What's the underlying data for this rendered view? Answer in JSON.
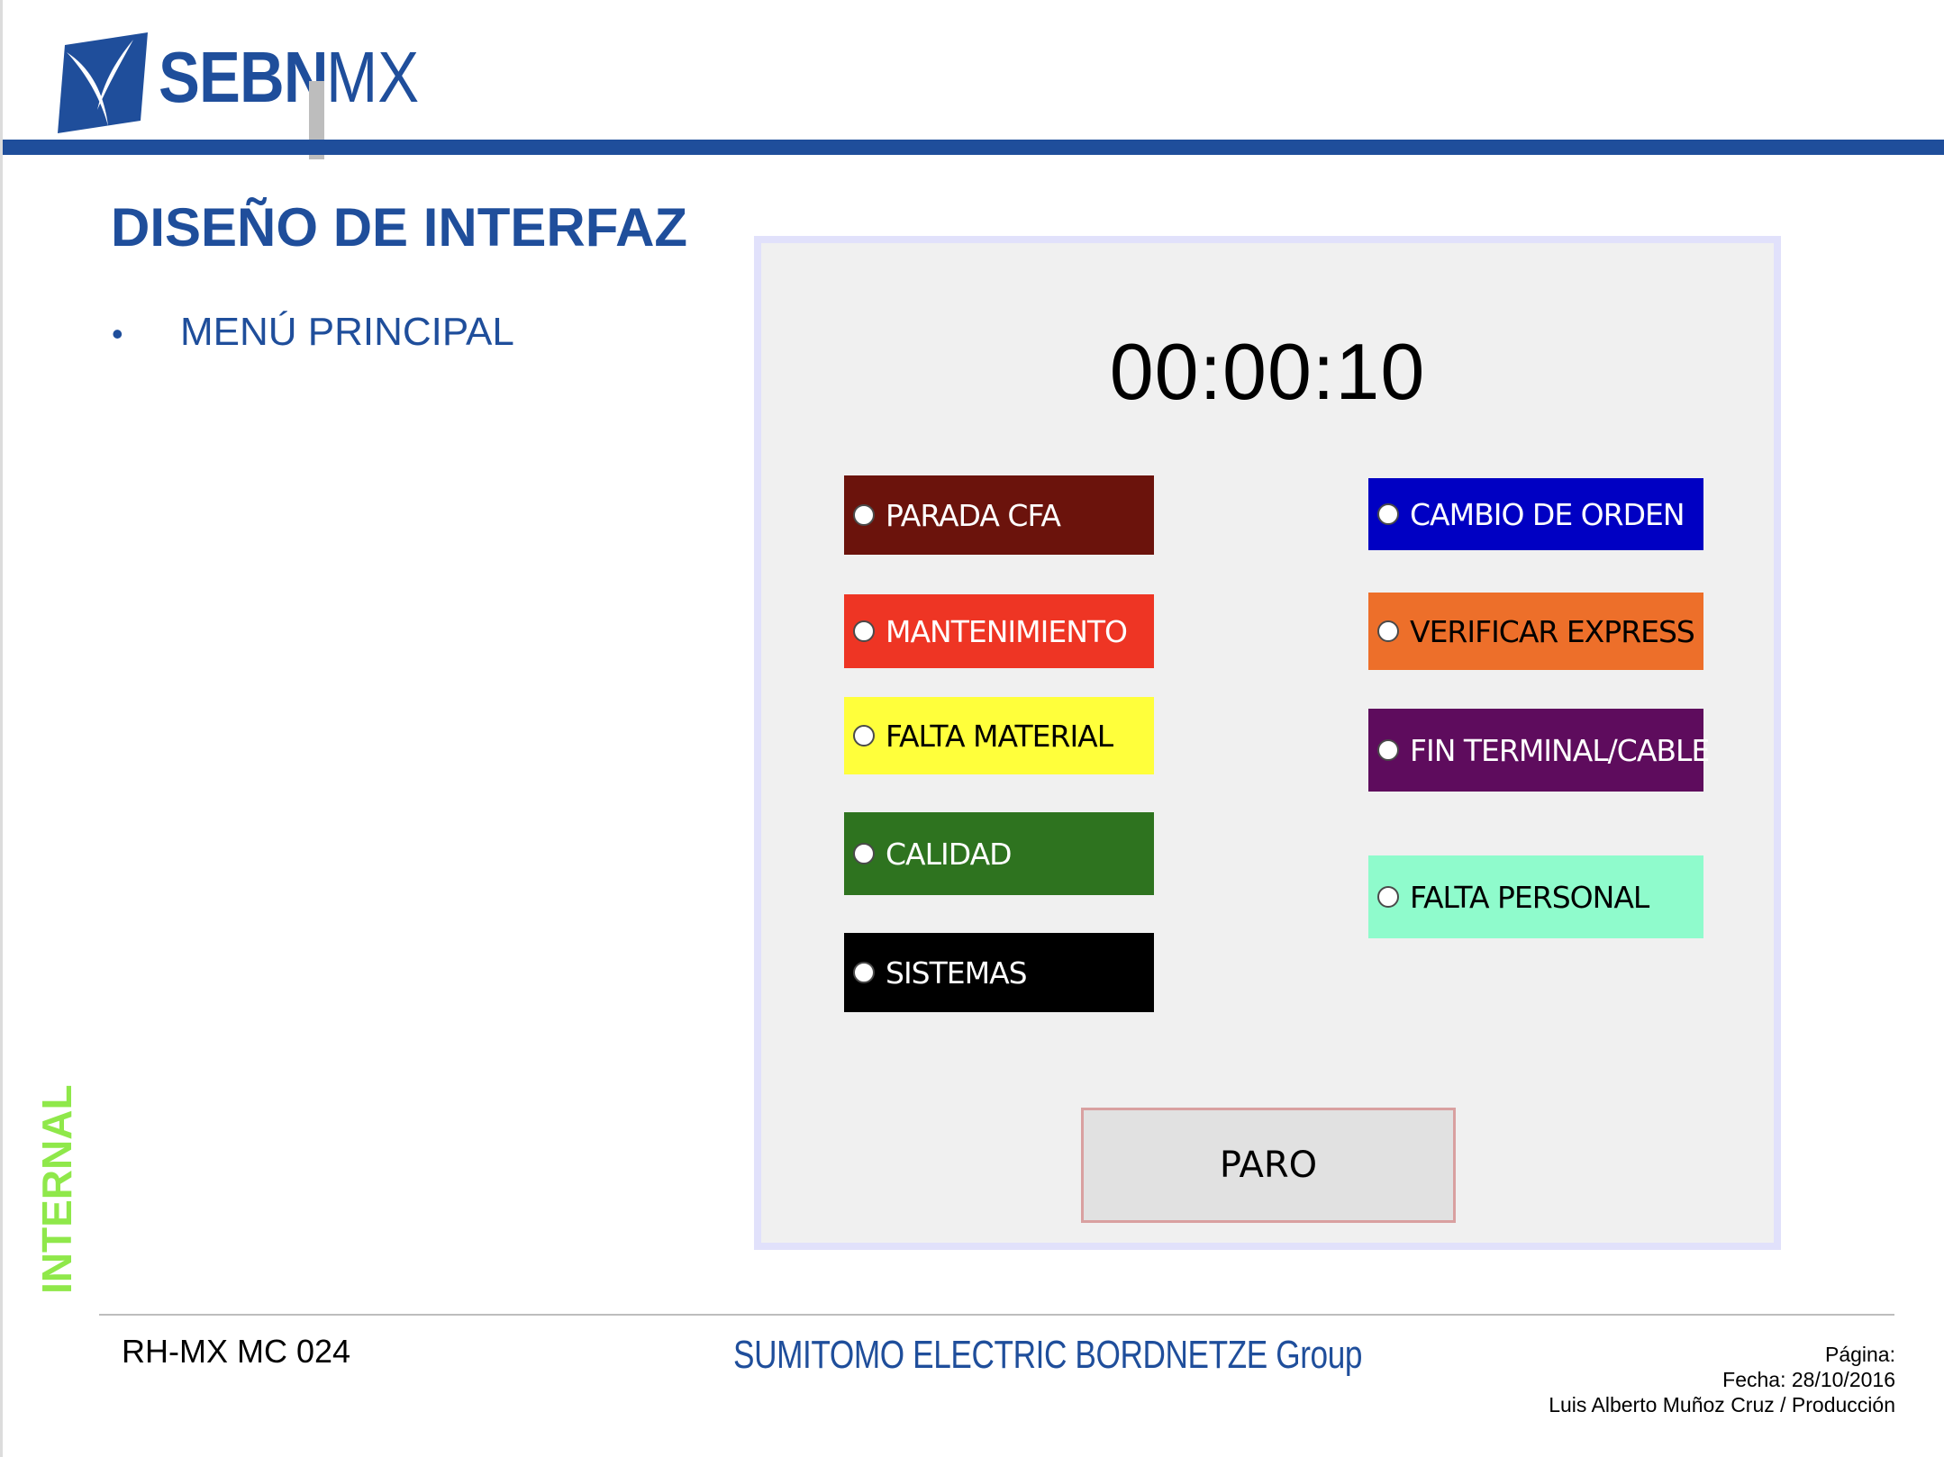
{
  "header": {
    "brand": "SEBN",
    "brand_suffix": "MX",
    "colors": {
      "brand_blue": "#1f4e9b",
      "separator_gray": "#bdbdbd"
    }
  },
  "slide": {
    "title": "DISEÑO DE INTERFAZ",
    "bullet": "MENÚ PRINCIPAL",
    "classification": "INTERNAL"
  },
  "app": {
    "timer": "00:00:10",
    "options_left": [
      {
        "label": "PARADA CFA",
        "bg": "#6b130c",
        "fg": "#ffffff"
      },
      {
        "label": "MANTENIMIENTO",
        "bg": "#ee3524",
        "fg": "#ffffff"
      },
      {
        "label": "FALTA MATERIAL",
        "bg": "#ffff3b",
        "fg": "#000000"
      },
      {
        "label": "CALIDAD",
        "bg": "#2e731f",
        "fg": "#ffffff"
      },
      {
        "label": "SISTEMAS",
        "bg": "#000000",
        "fg": "#ffffff"
      }
    ],
    "options_right": [
      {
        "label": "CAMBIO DE ORDEN",
        "bg": "#0000c3",
        "fg": "#ffffff"
      },
      {
        "label": "VERIFICAR EXPRESS",
        "bg": "#ed6f2a",
        "fg": "#000000"
      },
      {
        "label": "FIN TERMINAL/CABLE",
        "bg": "#5e0c5d",
        "fg": "#ffffff"
      },
      {
        "label": "FALTA PERSONAL",
        "bg": "#8ffbcc",
        "fg": "#000000"
      }
    ],
    "stop_button": "PARO"
  },
  "footer": {
    "doc_code": "RH-MX MC 024",
    "group": "SUMITOMO ELECTRIC BORDNETZE",
    "group_suffix": "Group",
    "page_label": "Página:",
    "date_line": "Fecha: 28/10/2016",
    "author_line": "Luis Alberto Muñoz Cruz / Producción"
  }
}
